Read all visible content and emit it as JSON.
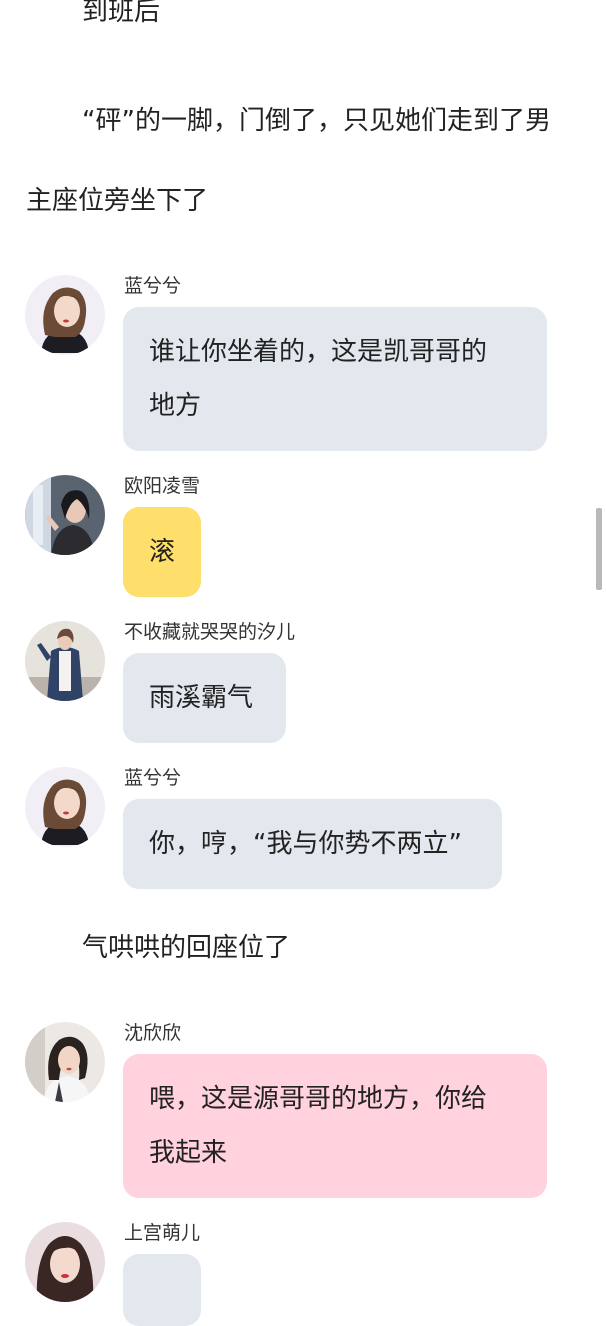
{
  "story": {
    "p1": "到班后",
    "p2_line1": "“砰”的一脚，门倒了，只见她们走到了男",
    "p2_line2": "主座位旁坐下了",
    "p3": "气哄哄的回座位了"
  },
  "messages": [
    {
      "sender": "蓝兮兮",
      "text_line1": "谁让你坐着的，这是凯哥哥的",
      "text_line2": "地方",
      "bubble_color": "#e3e8ee"
    },
    {
      "sender": "欧阳凌雪",
      "text_line1": "滚",
      "bubble_color": "#fedf6b"
    },
    {
      "sender": "不收藏就哭哭的汐儿",
      "text_line1": "雨溪霸气",
      "bubble_color": "#e3e8ee"
    },
    {
      "sender": "蓝兮兮",
      "text_line1": "你，哼，“我与你势不两立”",
      "bubble_color": "#e3e8ee"
    },
    {
      "sender": "沈欣欣",
      "text_line1": "喂，这是源哥哥的地方，你给",
      "text_line2": "我起来",
      "bubble_color": "#ffd2dd"
    },
    {
      "sender": "上宫萌儿",
      "text_line1": "",
      "bubble_color": "#e3e8ee"
    }
  ],
  "icons": {
    "avatar_1": "girl-portrait-avatar",
    "avatar_2": "girl-window-avatar",
    "avatar_3": "girl-denim-jacket-avatar",
    "avatar_4": "girl-portrait-avatar",
    "avatar_5": "girl-white-top-avatar",
    "avatar_6": "girl-red-lips-avatar"
  }
}
